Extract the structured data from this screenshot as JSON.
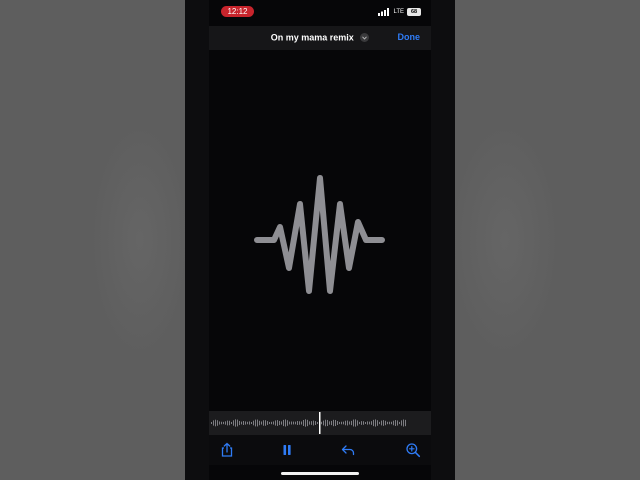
{
  "status_bar": {
    "time": "12:12",
    "network": "LTE",
    "battery": "68"
  },
  "header": {
    "title": "On my mama remix",
    "done_label": "Done"
  },
  "icons": {
    "title_menu": "chevron-down-icon",
    "share": "share-icon",
    "pause": "pause-icon",
    "undo": "undo-icon",
    "zoom": "zoom-in-icon"
  },
  "colors": {
    "accent": "#2f7cf6",
    "recording_pill": "#c8242c",
    "waveform": "#8e8e93"
  }
}
